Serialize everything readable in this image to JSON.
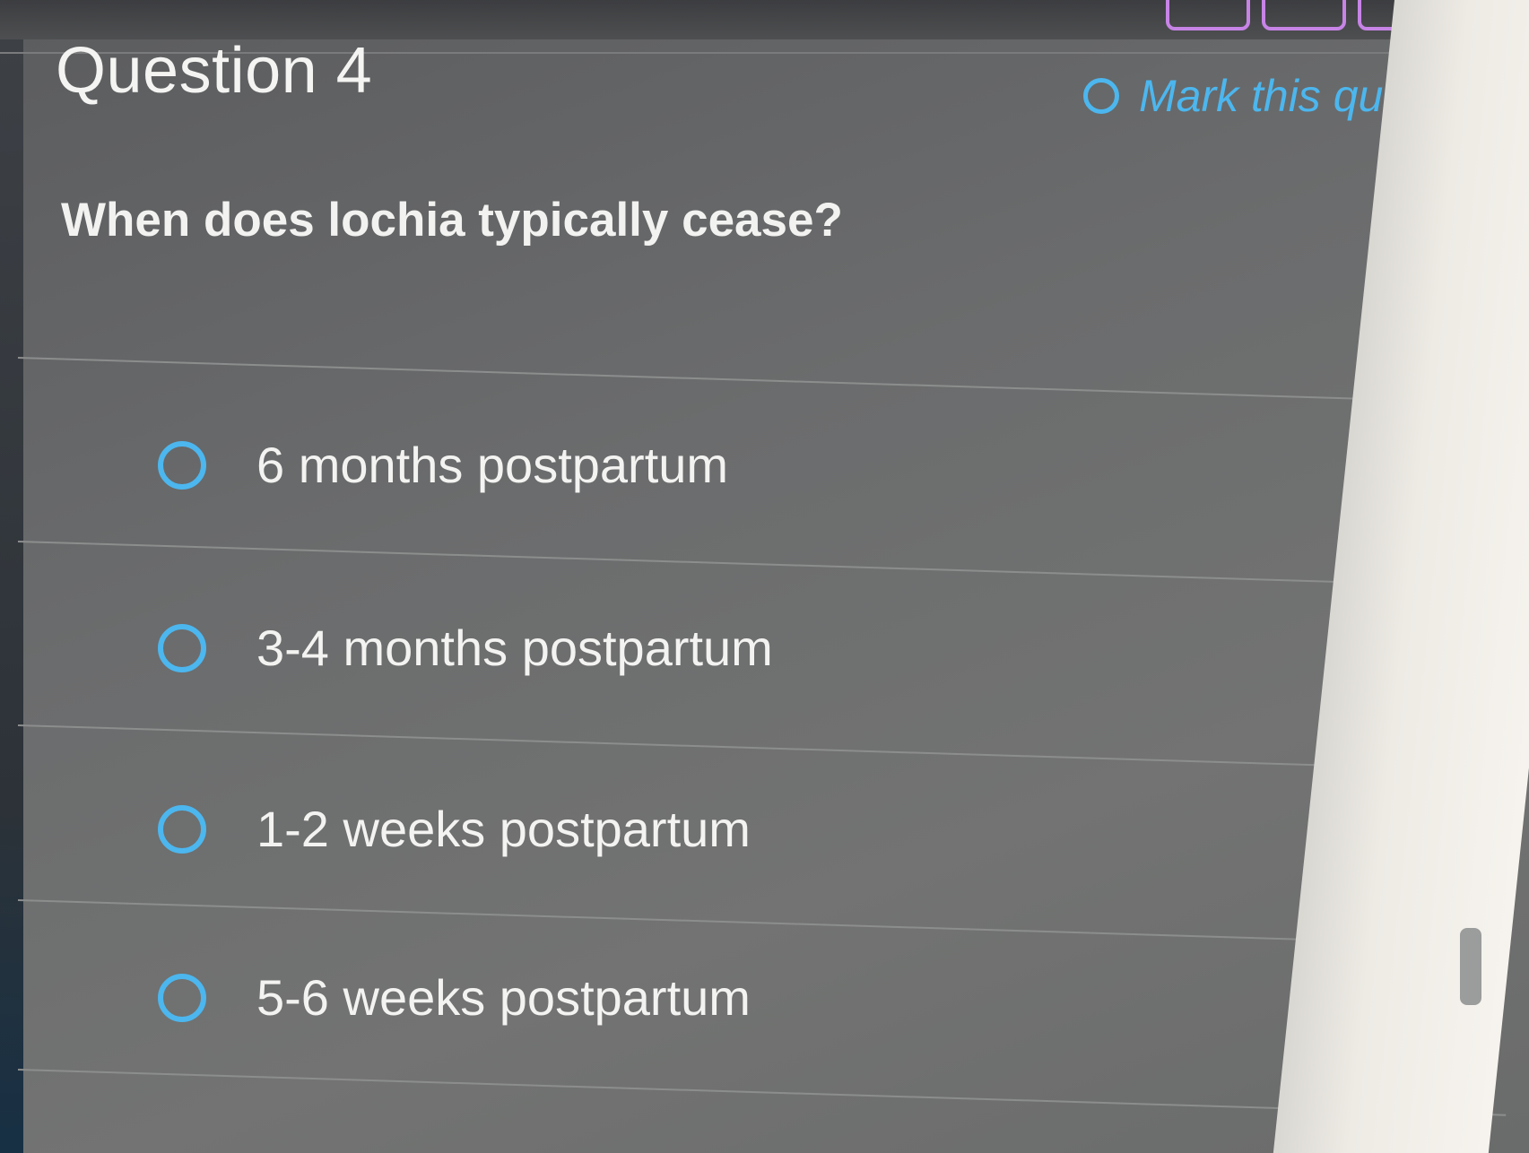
{
  "header": {
    "title": "Question 4",
    "mark_label": "Mark this question"
  },
  "question": {
    "prompt": "When does lochia typically cease?"
  },
  "options": [
    {
      "label": "6 months postpartum",
      "selected": false
    },
    {
      "label": "3-4 months postpartum",
      "selected": false
    },
    {
      "label": "1-2 weeks postpartum",
      "selected": false
    },
    {
      "label": "5-6 weeks postpartum",
      "selected": false
    }
  ],
  "colors": {
    "accent": "#4cb6ee",
    "nav_accent": "#c983e8",
    "text": "#f3f3f1",
    "panel": "#6b6c6d"
  },
  "icons": {
    "radio": "radio-unchecked-icon",
    "mark": "circle-outline-icon"
  }
}
